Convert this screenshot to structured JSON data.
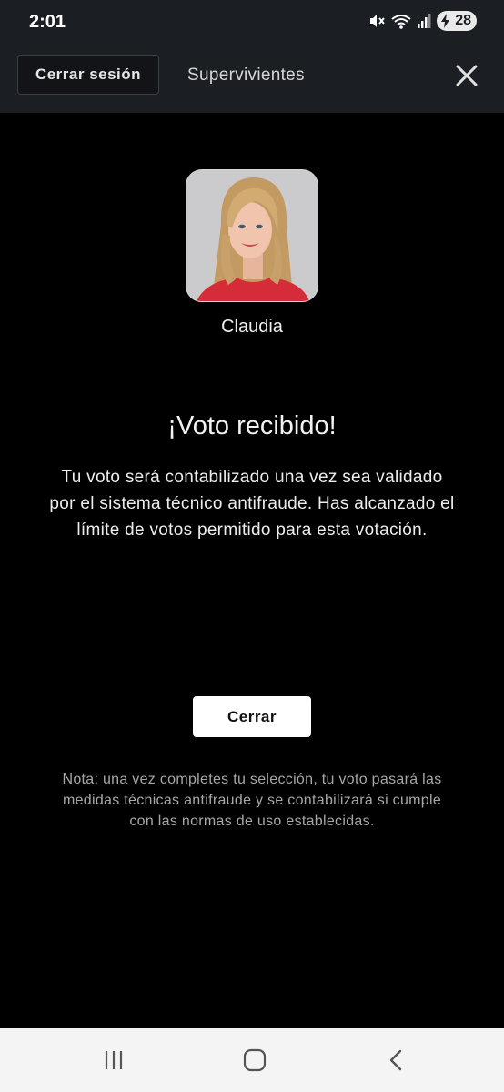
{
  "status_bar": {
    "time": "2:01",
    "battery": "28",
    "icons": [
      "mute-icon",
      "wifi-icon",
      "signal-icon",
      "battery-charging-icon"
    ]
  },
  "header": {
    "logout_label": "Cerrar sesión",
    "title": "Supervivientes",
    "close_icon": "close-icon"
  },
  "contestant": {
    "name": "Claudia"
  },
  "confirmation": {
    "title": "¡Voto recibido!",
    "message": "Tu voto será contabilizado una vez sea validado por el sistema técnico antifraude. Has alcanzado el límite de votos permitido para esta votación.",
    "close_label": "Cerrar",
    "note": "Nota: una vez completes tu selección, tu voto pasará las medidas técnicas antifraude y se contabilizará si cumple con las normas de uso establecidas."
  },
  "nav_bar": {
    "buttons": [
      "recent-apps-icon",
      "home-icon",
      "back-icon"
    ]
  },
  "colors": {
    "background": "#000000",
    "header": "#1b1e22",
    "button": "#ffffff",
    "note_text": "#a7a7a7"
  }
}
